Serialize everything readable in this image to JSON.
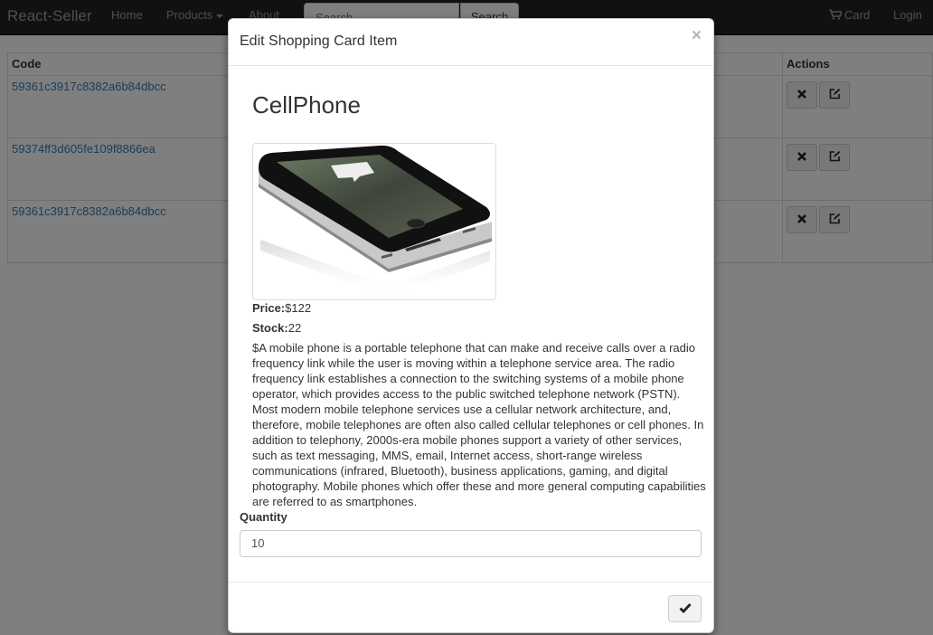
{
  "navbar": {
    "brand": "React-Seller",
    "links": [
      "Home",
      "Products",
      "About"
    ],
    "search_placeholder": "Search",
    "search_button": "Search",
    "cart_label": "Card",
    "login_label": "Login"
  },
  "table": {
    "headers": {
      "code": "Code",
      "actions": "Actions"
    },
    "rows": [
      {
        "code": "59361c3917c8382a6b84dbcc"
      },
      {
        "code": "59374ff3d605fe109f8866ea"
      },
      {
        "code": "59361c3917c8382a6b84dbcc"
      }
    ]
  },
  "modal": {
    "title": "Edit Shopping Card Item",
    "close": "×",
    "product": {
      "name": "CellPhone",
      "price_label": "Price:",
      "price_value": "$122",
      "stock_label": "Stock:",
      "stock_value": "22",
      "description": "$A mobile phone is a portable telephone that can make and receive calls over a radio frequency link while the user is moving within a telephone service area. The radio frequency link establishes a connection to the switching systems of a mobile phone operator, which provides access to the public switched telephone network (PSTN). Most modern mobile telephone services use a cellular network architecture, and, therefore, mobile telephones are often also called cellular telephones or cell phones. In addition to telephony, 2000s-era mobile phones support a variety of other services, such as text messaging, MMS, email, Internet access, short-range wireless communications (infrared, Bluetooth), business applications, gaming, and digital photography. Mobile phones which offer these and more general computing capabilities are referred to as smartphones."
    },
    "quantity_label": "Quantity",
    "quantity_value": "10",
    "confirm_icon": "check-icon"
  }
}
